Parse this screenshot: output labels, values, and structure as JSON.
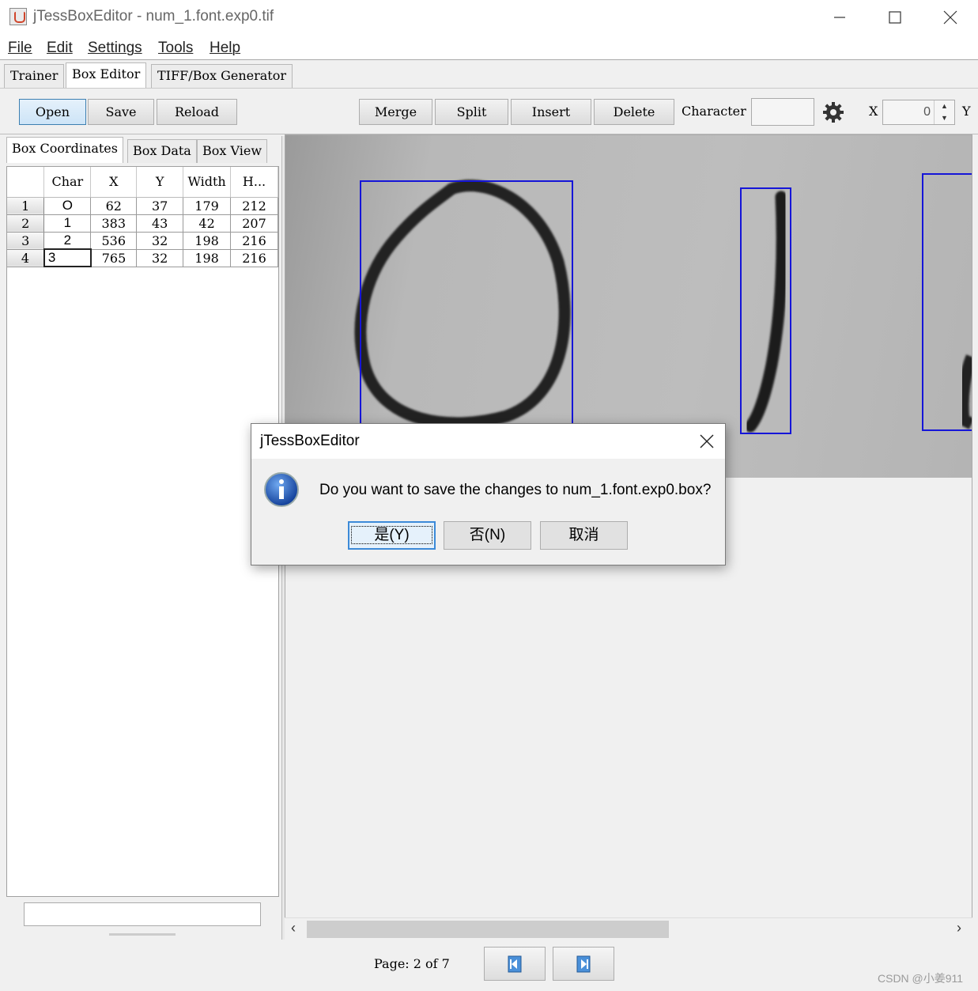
{
  "window": {
    "title": "jTessBoxEditor - num_1.font.exp0.tif"
  },
  "menu": [
    "File",
    "Edit",
    "Settings",
    "Tools",
    "Help"
  ],
  "main_tabs": [
    "Trainer",
    "Box Editor",
    "TIFF/Box Generator"
  ],
  "toolbar": {
    "open": "Open",
    "save": "Save",
    "reload": "Reload",
    "merge": "Merge",
    "split": "Split",
    "insert": "Insert",
    "delete": "Delete",
    "character_label": "Character",
    "character_value": "",
    "x_label": "X",
    "x_value": "0",
    "y_label": "Y"
  },
  "sub_tabs": [
    "Box Coordinates",
    "Box Data",
    "Box View"
  ],
  "table": {
    "headers": [
      "Char",
      "X",
      "Y",
      "Width",
      "H..."
    ],
    "rows": [
      {
        "n": "1",
        "char": "O",
        "x": "62",
        "y": "37",
        "w": "179",
        "h": "212"
      },
      {
        "n": "2",
        "char": "1",
        "x": "383",
        "y": "43",
        "w": "42",
        "h": "207"
      },
      {
        "n": "3",
        "char": "2",
        "x": "536",
        "y": "32",
        "w": "198",
        "h": "216"
      },
      {
        "n": "4",
        "char": "3",
        "x": "765",
        "y": "32",
        "w": "198",
        "h": "216"
      }
    ]
  },
  "status": {
    "page_label": "Page: 2 of 7"
  },
  "dialog": {
    "title": "jTessBoxEditor",
    "message": "Do you want to save the changes to num_1.font.exp0.box?",
    "yes": "是(Y)",
    "no": "否(N)",
    "cancel": "取消"
  },
  "watermark": "CSDN @小姜911",
  "colors": {
    "box_outline": "#1515d8",
    "accent": "#3c8ad8"
  }
}
